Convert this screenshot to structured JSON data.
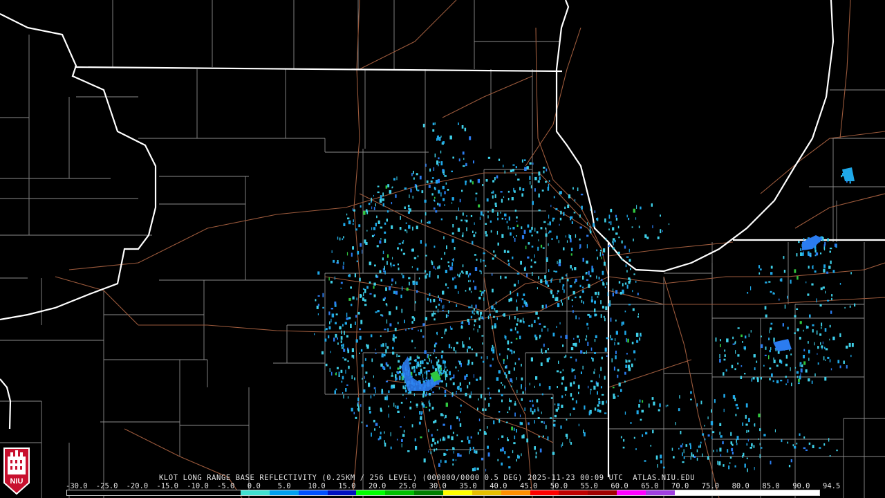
{
  "product": {
    "caption": "KLOT LONG RANGE BASE REFLECTIVITY (0.25KM / 256 LEVEL) (000000/0000 0.5 DEG) 2025-11-23 00:09 UTC  ATLAS.NIU.EDU"
  },
  "logo": {
    "text": "NIU",
    "color": "#c8102e"
  },
  "colorbar": {
    "tick_labels": [
      "-30.0",
      "-25.0",
      "-20.0",
      "-15.0",
      "-10.0",
      "-5.0",
      "0.0",
      "5.0",
      "10.0",
      "15.0",
      "20.0",
      "25.0",
      "30.0",
      "35.0",
      "40.0",
      "45.0",
      "50.0",
      "55.0",
      "60.0",
      "65.0",
      "70.0",
      "75.0",
      "80.0",
      "85.0",
      "90.0",
      "94.5"
    ],
    "colors": [
      "#000000",
      "#000000",
      "#000000",
      "#000000",
      "#000000",
      "#000000",
      "#40e0d0",
      "#00a0f0",
      "#0050ff",
      "#0010c0",
      "#00ff00",
      "#00c000",
      "#008000",
      "#ffff00",
      "#e6c000",
      "#ff9000",
      "#ff0000",
      "#c00000",
      "#a00000",
      "#ff00ff",
      "#a040e0",
      "#ffffff",
      "#ffffff",
      "#ffffff",
      "#ffffff",
      "#ffffff"
    ]
  },
  "map": {
    "background": "#000000",
    "state_line_color": "#ffffff",
    "county_line_color": "#8c8c8c",
    "highway_color": "#9c5a3c",
    "echo_colors": [
      "#3fd0e8",
      "#1fa8e8",
      "#2b7cf0",
      "#2f5fe0",
      "#30c840"
    ]
  }
}
